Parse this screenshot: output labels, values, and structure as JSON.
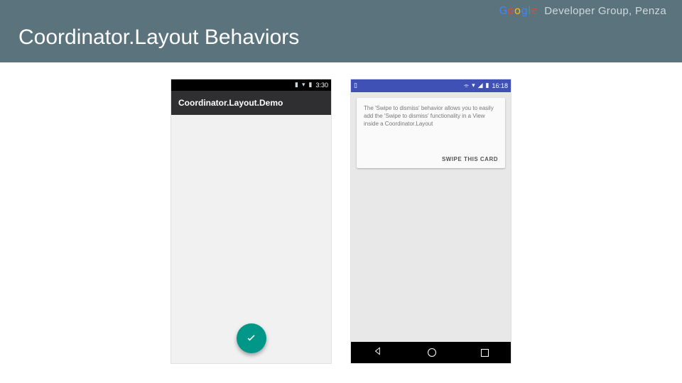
{
  "header": {
    "brand_letters": [
      "G",
      "o",
      "o",
      "g",
      "l",
      "e"
    ],
    "brand_rest": "Developer Group, Penza",
    "title": "Coordinator.Layout Behaviors"
  },
  "phone1": {
    "status_time": "3:30",
    "appbar_title": "Coordinator.Layout.Demo",
    "fab_icon_name": "check-icon"
  },
  "phone2": {
    "status_time": "16:18",
    "card_text": "The 'Swipe to dismiss' behavior allows you to easily add the 'Swipe to dismiss' functionality in a View inside a Coordinator.Layout",
    "card_action": "SWIPE THIS CARD"
  }
}
